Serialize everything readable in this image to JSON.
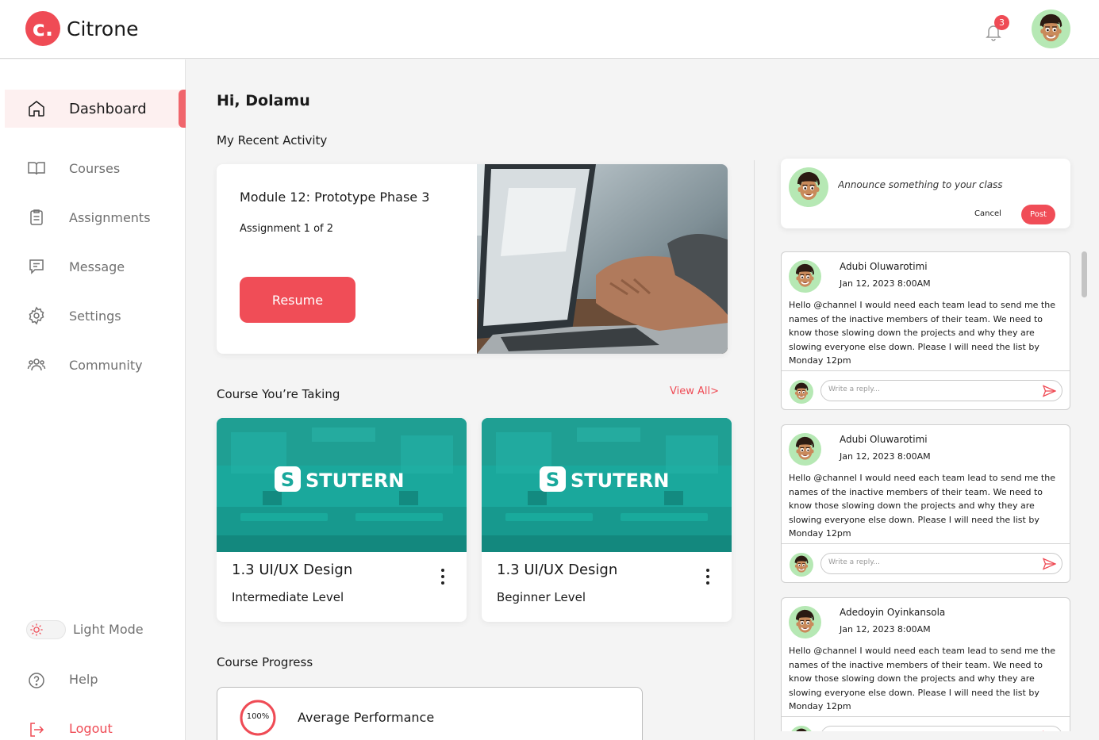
{
  "brand": {
    "mark": "c.",
    "name": "Citrone",
    "accent": "#ef4b55"
  },
  "header": {
    "notification_count": "3",
    "notification_icon": "bell-icon",
    "avatar_icon": "memoji-avatar"
  },
  "sidebar": {
    "items": [
      {
        "label": "Dashboard",
        "icon": "home-icon",
        "active": true
      },
      {
        "label": "Courses",
        "icon": "book-icon"
      },
      {
        "label": "Assignments",
        "icon": "clipboard-icon"
      },
      {
        "label": "Message",
        "icon": "chat-icon"
      },
      {
        "label": "Settings",
        "icon": "gear-icon"
      },
      {
        "label": "Community",
        "icon": "people-icon"
      }
    ],
    "mode_label": "Light Mode",
    "help_label": "Help",
    "logout_label": "Logout"
  },
  "main": {
    "greeting": "Hi, Dolamu",
    "recent_title": "My Recent Activity",
    "activity": {
      "title": "Module 12: Prototype Phase 3",
      "subtitle": "Assignment 1 of 2",
      "button": "Resume"
    },
    "courses_title": "Course You’re Taking",
    "view_all": "View All>",
    "courses": [
      {
        "brand": "STUTERN",
        "logo_letter": "S",
        "title": "1.3 UI/UX Design",
        "level": "Intermediate Level"
      },
      {
        "brand": "STUTERN",
        "logo_letter": "S",
        "title": "1.3 UI/UX Design",
        "level": "Beginner Level"
      }
    ],
    "progress_title": "Course Progress",
    "progress": {
      "value": "100%",
      "fraction": 1.0,
      "label": "Average Performance"
    }
  },
  "feed": {
    "announce_placeholder": "Announce something to your class",
    "cancel": "Cancel",
    "post": "Post",
    "reply_placeholder": "Write a reply...",
    "posts": [
      {
        "author": "Adubi Oluwarotimi",
        "date": "Jan 12, 2023  8:00AM",
        "body": "Hello @channel I would need each team lead to send me the names of the inactive members of their team. We need to know those slowing down the projects and why they are slowing everyone else down. Please I will need the list by Monday 12pm"
      },
      {
        "author": "Adubi Oluwarotimi",
        "date": "Jan 12, 2023  8:00AM",
        "body": "Hello @channel I would need each team lead to send me the names of the inactive members of their team. We need to know those slowing down the projects and why they are slowing everyone else down. Please I will need the list by Monday 12pm"
      },
      {
        "author": "Adedoyin Oyinkansola",
        "date": "Jan 12, 2023  8:00AM",
        "body": "Hello @channel I would need each team lead to send me the names of the inactive members of their team. We need to know those slowing down the projects and why they are slowing everyone else down. Please I will need the list by Monday 12pm"
      }
    ]
  }
}
